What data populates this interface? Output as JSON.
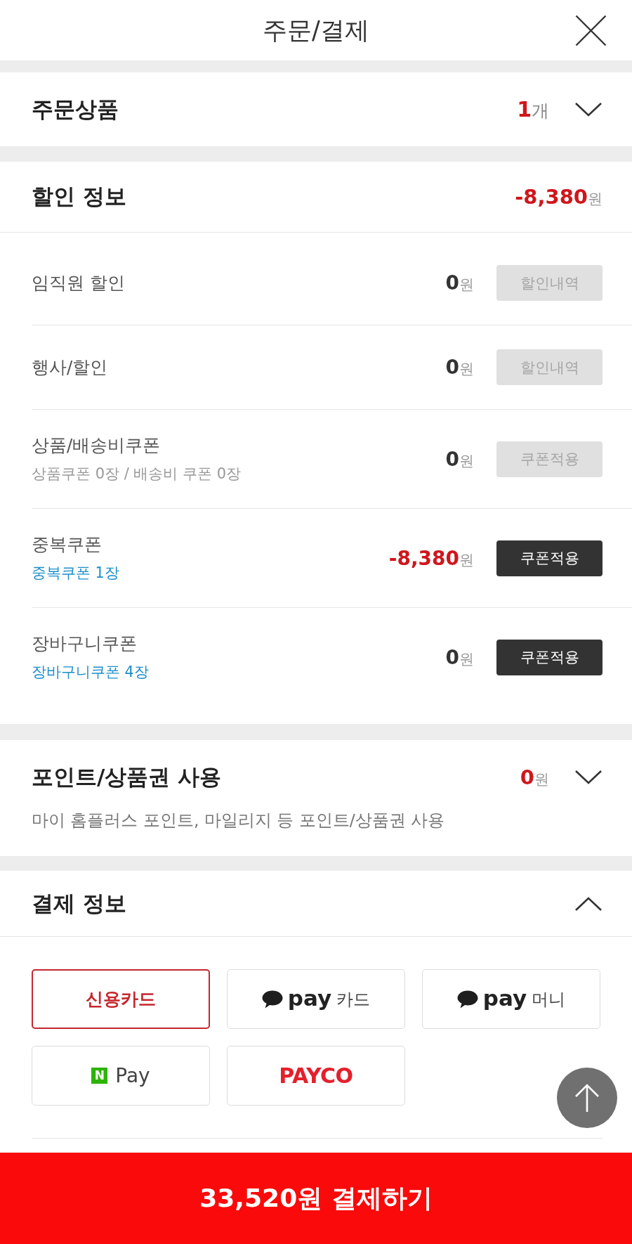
{
  "header": {
    "title": "주문/결제"
  },
  "order_items": {
    "title": "주문상품",
    "count": "**1**개",
    "expanded": false
  },
  "discount": {
    "title": "할인 정보",
    "total": "**-8,380**원",
    "rows": [
      {
        "label": "임직원 할인",
        "amount": "**0**원",
        "applied": false,
        "button": {
          "label": "할인내역",
          "disabled": true
        }
      },
      {
        "label": "행사/할인",
        "amount": "**0**원",
        "applied": false,
        "button": {
          "label": "할인내역",
          "disabled": true
        }
      },
      {
        "label": "상품/배송비쿠폰",
        "note": {
          "text": "상품쿠폰 0장 / 배송비 쿠폰 0장",
          "link": false
        },
        "amount": "**0**원",
        "applied": false,
        "button": {
          "label": "쿠폰적용",
          "disabled": true
        }
      },
      {
        "label": "중복쿠폰",
        "note": {
          "text": "중복쿠폰 1장",
          "link": true
        },
        "amount": "**-8,380**원",
        "applied": true,
        "button": {
          "label": "쿠폰적용",
          "disabled": false
        }
      },
      {
        "label": "장바구니쿠폰",
        "note": {
          "text": "장바구니쿠폰 4장",
          "link": true
        },
        "amount": "**0**원",
        "applied": false,
        "button": {
          "label": "쿠폰적용",
          "disabled": false
        }
      }
    ]
  },
  "points": {
    "title": "포인트/상품권 사용",
    "amount": "**0**원",
    "expanded": false,
    "description": "마이 홈플러스 포인트, 마일리지 등 포인트/상품권 사용"
  },
  "payment": {
    "title": "결제 정보",
    "expanded": true,
    "methods": [
      {
        "kind": "card",
        "label": "신용카드",
        "selected": true
      },
      {
        "kind": "kakaopay",
        "brand": "pay",
        "label": "카드",
        "selected": false
      },
      {
        "kind": "kakaopay",
        "brand": "pay",
        "label": "머니",
        "selected": false
      },
      {
        "kind": "naverpay",
        "badge": "N",
        "label": "Pay",
        "selected": false
      },
      {
        "kind": "payco",
        "label": "PAYCO",
        "selected": false
      }
    ]
  },
  "pay_button": {
    "label": "33,520원 결제하기"
  }
}
